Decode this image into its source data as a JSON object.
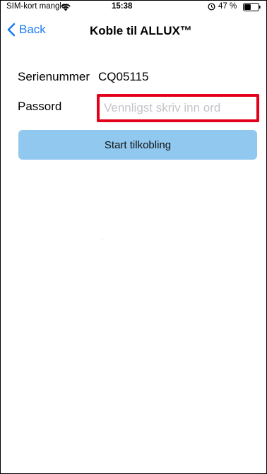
{
  "status_bar": {
    "carrier": "SIM-kort mangler",
    "time": "15:38",
    "battery_percent": "47 %",
    "battery_level": 0.47,
    "icons": [
      "wifi-icon",
      "alarm-icon",
      "battery-icon"
    ]
  },
  "nav": {
    "back_label": "Back",
    "title": "Koble til ALLUX™",
    "back_icon": "chevron-left-icon"
  },
  "form": {
    "serial_label": "Serienummer",
    "serial_value": "CQ05115",
    "password_label": "Passord",
    "password_value": "",
    "password_placeholder": "Vennligst skriv inn ord",
    "start_button_label": "Start tilkobling"
  },
  "colors": {
    "accent": "#1a7cf5",
    "button_background": "#90c8ef",
    "highlight_border": "#e3001b"
  }
}
